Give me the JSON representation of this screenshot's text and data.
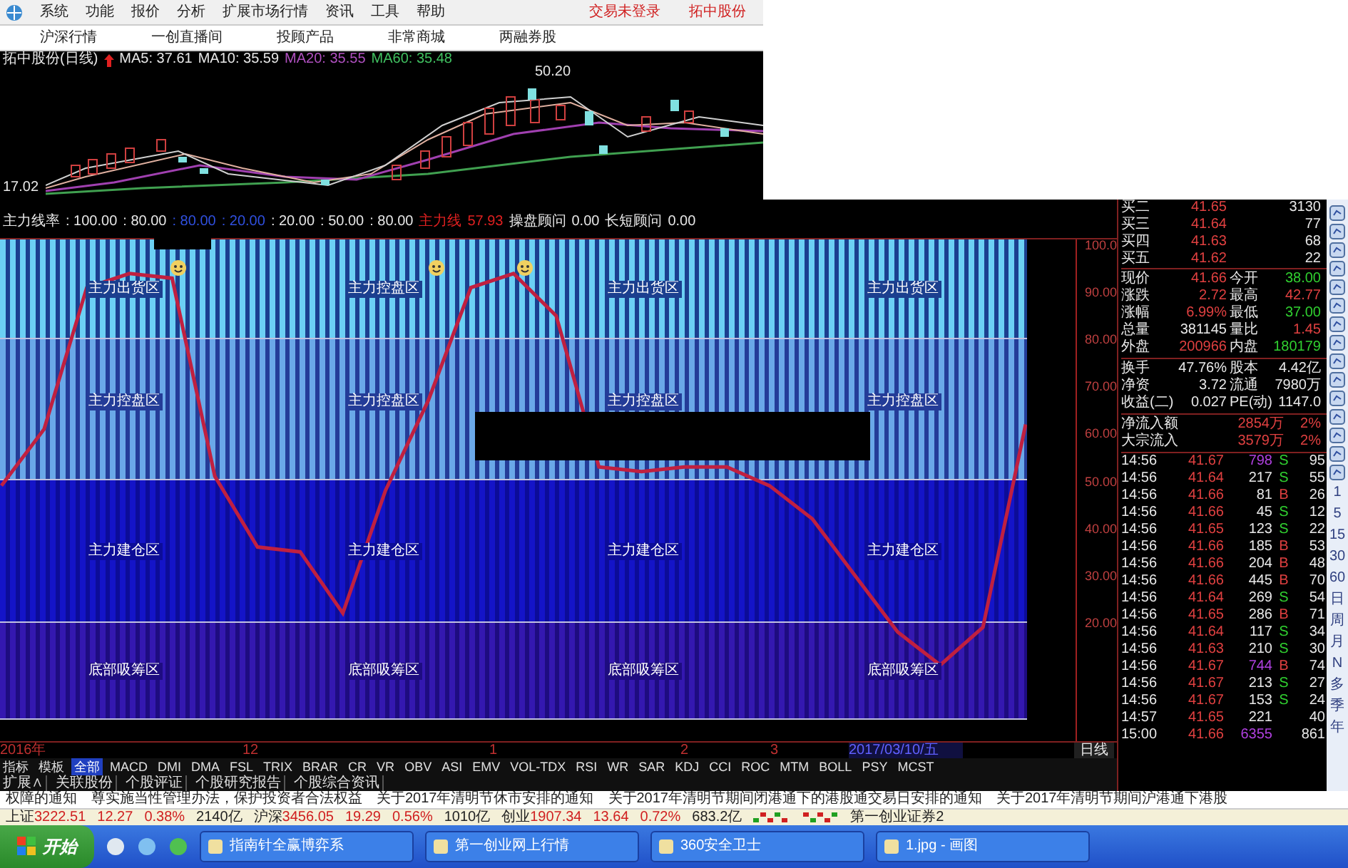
{
  "menu_bar": {
    "items": [
      "系统",
      "功能",
      "报价",
      "分析",
      "扩展市场行情",
      "资讯",
      "工具",
      "帮助"
    ],
    "status": [
      "交易未登录",
      "拓中股份"
    ]
  },
  "toolbar": {
    "items": [
      "沪深行情",
      "一创直播间",
      "投顾产品",
      "非常商城",
      "两融券股"
    ]
  },
  "kline": {
    "title": "拓中股份(日线)",
    "ma": [
      {
        "label": "MA5: 37.61",
        "color": "#e8e8e8"
      },
      {
        "label": "MA10: 35.59",
        "color": "#e8e8e8"
      },
      {
        "label": "MA20: 35.55",
        "color": "#b050c0"
      },
      {
        "label": "MA60: 35.48",
        "color": "#40c060"
      }
    ],
    "high_label": "50.20",
    "low_label": "17.02"
  },
  "indicator": {
    "header": [
      {
        "text": "主力线率",
        "color": "#e8e8e8"
      },
      {
        "text": ": 100.00",
        "color": "#e8e8e8"
      },
      {
        "text": ": 80.00",
        "color": "#e8e8e8"
      },
      {
        "text": ": 80.00",
        "color": "#3050e0"
      },
      {
        "text": ": 20.00",
        "color": "#3050e0"
      },
      {
        "text": ": 20.00",
        "color": "#e8e8e8"
      },
      {
        "text": ": 50.00",
        "color": "#e8e8e8"
      },
      {
        "text": ": 80.00",
        "color": "#e8e8e8"
      },
      {
        "text": "主力线",
        "color": "#e02020"
      },
      {
        "text": "57.93",
        "color": "#e02020"
      },
      {
        "text": "操盘顾问",
        "color": "#e8e8e8"
      },
      {
        "text": "0.00",
        "color": "#e8e8e8"
      },
      {
        "text": "长短顾问",
        "color": "#e8e8e8"
      },
      {
        "text": "0.00",
        "color": "#e8e8e8"
      }
    ],
    "zones": [
      {
        "kind": "top",
        "labels": [
          "主力出货区",
          "主力控盘区",
          "主力出货区",
          "主力出货区"
        ]
      },
      {
        "kind": "upper",
        "labels": [
          "主力控盘区",
          "主力控盘区",
          "主力控盘区",
          "主力控盘区"
        ]
      },
      {
        "kind": "lower",
        "labels": [
          "主力建仓区",
          "主力建仓区",
          "主力建仓区",
          "主力建仓区"
        ]
      },
      {
        "kind": "bottom",
        "labels": [
          "底部吸筹区",
          "底部吸筹区",
          "底部吸筹区",
          "底部吸筹区"
        ]
      }
    ],
    "chart_data": {
      "type": "line",
      "grid": true,
      "ylim": [
        0,
        100
      ],
      "yticks": [
        {
          "value": 100,
          "label": "100.0"
        },
        {
          "value": 90,
          "label": "90.00"
        },
        {
          "value": 80,
          "label": "80.00"
        },
        {
          "value": 70,
          "label": "70.00"
        },
        {
          "value": 60,
          "label": "60.00"
        },
        {
          "value": 50,
          "label": "50.00"
        },
        {
          "value": 40,
          "label": "40.00"
        },
        {
          "value": 30,
          "label": "30.00"
        },
        {
          "value": 20,
          "label": "20.00"
        }
      ],
      "series": [
        {
          "color": "#c02040",
          "values": [
            49,
            61,
            91,
            94,
            93,
            51,
            36,
            35,
            22,
            48,
            67,
            91,
            94,
            85,
            53,
            52,
            53,
            53,
            49,
            42,
            30,
            18,
            11,
            19,
            62
          ]
        }
      ]
    },
    "x_axis": [
      {
        "label": "2016年",
        "selected": false
      },
      {
        "label": "12",
        "selected": false
      },
      {
        "label": "1",
        "selected": false
      },
      {
        "label": "2",
        "selected": false
      },
      {
        "label": "3",
        "selected": false
      },
      {
        "label": "2017/03/10/五",
        "selected": true
      }
    ],
    "period_label": "日线"
  },
  "indicator_tabs": [
    {
      "label": "指标",
      "selected": false
    },
    {
      "label": "模板",
      "selected": false
    },
    {
      "label": "全部",
      "selected": true
    },
    {
      "label": "MACD",
      "selected": false
    },
    {
      "label": "DMI",
      "selected": false
    },
    {
      "label": "DMA",
      "selected": false
    },
    {
      "label": "FSL",
      "selected": false
    },
    {
      "label": "TRIX",
      "selected": false
    },
    {
      "label": "BRAR",
      "selected": false
    },
    {
      "label": "CR",
      "selected": false
    },
    {
      "label": "VR",
      "selected": false
    },
    {
      "label": "OBV",
      "selected": false
    },
    {
      "label": "ASI",
      "selected": false
    },
    {
      "label": "EMV",
      "selected": false
    },
    {
      "label": "VOL-TDX",
      "selected": false
    },
    {
      "label": "RSI",
      "selected": false
    },
    {
      "label": "WR",
      "selected": false
    },
    {
      "label": "SAR",
      "selected": false
    },
    {
      "label": "KDJ",
      "selected": false
    },
    {
      "label": "CCI",
      "selected": false
    },
    {
      "label": "ROC",
      "selected": false
    },
    {
      "label": "MTM",
      "selected": false
    },
    {
      "label": "BOLL",
      "selected": false
    },
    {
      "label": "PSY",
      "selected": false
    },
    {
      "label": "MCST",
      "selected": false
    }
  ],
  "extension_tabs": [
    "扩展∧",
    "关联股份",
    "个股评证",
    "个股研究报告",
    "个股综合资讯"
  ],
  "quote": {
    "bids": [
      {
        "label": "买二",
        "price": "41.65",
        "volume": "3130"
      },
      {
        "label": "买三",
        "price": "41.64",
        "volume": "77"
      },
      {
        "label": "买四",
        "price": "41.63",
        "volume": "68"
      },
      {
        "label": "买五",
        "price": "41.62",
        "volume": "22"
      }
    ],
    "stat_groups": [
      [
        [
          {
            "label": "现价",
            "value": "41.66",
            "color": "#e04040"
          },
          {
            "label": "今开",
            "value": "38.00",
            "color": "#30d030"
          }
        ],
        [
          {
            "label": "涨跌",
            "value": "2.72",
            "color": "#e04040"
          },
          {
            "label": "最高",
            "value": "42.77",
            "color": "#e04040"
          }
        ],
        [
          {
            "label": "涨幅",
            "value": "6.99%",
            "color": "#e04040"
          },
          {
            "label": "最低",
            "value": "37.00",
            "color": "#30d030"
          }
        ],
        [
          {
            "label": "总量",
            "value": "381145",
            "color": "#e8e8e8"
          },
          {
            "label": "量比",
            "value": "1.45",
            "color": "#e04040"
          }
        ],
        [
          {
            "label": "外盘",
            "value": "200966",
            "color": "#e04040"
          },
          {
            "label": "内盘",
            "value": "180179",
            "color": "#30d030"
          }
        ]
      ],
      [
        [
          {
            "label": "换手",
            "value": "47.76%",
            "color": "#e8e8e8"
          },
          {
            "label": "股本",
            "value": "4.42亿",
            "color": "#e8e8e8"
          }
        ],
        [
          {
            "label": "净资",
            "value": "3.72",
            "color": "#e8e8e8"
          },
          {
            "label": "流通",
            "value": "7980万",
            "color": "#e8e8e8"
          }
        ],
        [
          {
            "label": "收益(二)",
            "value": "0.027",
            "color": "#e8e8e8"
          },
          {
            "label": "PE(动)",
            "value": "1147.0",
            "color": "#e8e8e8"
          }
        ]
      ]
    ],
    "flows": [
      {
        "label": "净流入额",
        "value": "2854万",
        "pct": "2%"
      },
      {
        "label": "大宗流入",
        "value": "3579万",
        "pct": "2%"
      }
    ],
    "ticks": [
      {
        "time": "14:56",
        "price": "41.67",
        "volume": "798",
        "large": true,
        "kind": "sell",
        "side": "S",
        "count": "95"
      },
      {
        "time": "14:56",
        "price": "41.64",
        "volume": "217",
        "large": false,
        "kind": "sell",
        "side": "S",
        "count": "55"
      },
      {
        "time": "14:56",
        "price": "41.66",
        "volume": "81",
        "large": false,
        "kind": "buy",
        "side": "B",
        "count": "26"
      },
      {
        "time": "14:56",
        "price": "41.66",
        "volume": "45",
        "large": false,
        "kind": "sell",
        "side": "S",
        "count": "12"
      },
      {
        "time": "14:56",
        "price": "41.65",
        "volume": "123",
        "large": false,
        "kind": "sell",
        "side": "S",
        "count": "22"
      },
      {
        "time": "14:56",
        "price": "41.66",
        "volume": "185",
        "large": false,
        "kind": "buy",
        "side": "B",
        "count": "53"
      },
      {
        "time": "14:56",
        "price": "41.66",
        "volume": "204",
        "large": false,
        "kind": "buy",
        "side": "B",
        "count": "48"
      },
      {
        "time": "14:56",
        "price": "41.66",
        "volume": "445",
        "large": false,
        "kind": "buy",
        "side": "B",
        "count": "70"
      },
      {
        "time": "14:56",
        "price": "41.64",
        "volume": "269",
        "large": false,
        "kind": "sell",
        "side": "S",
        "count": "54"
      },
      {
        "time": "14:56",
        "price": "41.65",
        "volume": "286",
        "large": false,
        "kind": "buy",
        "side": "B",
        "count": "71"
      },
      {
        "time": "14:56",
        "price": "41.64",
        "volume": "117",
        "large": false,
        "kind": "sell",
        "side": "S",
        "count": "34"
      },
      {
        "time": "14:56",
        "price": "41.63",
        "volume": "210",
        "large": false,
        "kind": "sell",
        "side": "S",
        "count": "30"
      },
      {
        "time": "14:56",
        "price": "41.67",
        "volume": "744",
        "large": true,
        "kind": "buy",
        "side": "B",
        "count": "74"
      },
      {
        "time": "14:56",
        "price": "41.67",
        "volume": "213",
        "large": false,
        "kind": "sell",
        "side": "S",
        "count": "27"
      },
      {
        "time": "14:56",
        "price": "41.67",
        "volume": "153",
        "large": false,
        "kind": "sell",
        "side": "S",
        "count": "24"
      },
      {
        "time": "14:57",
        "price": "41.65",
        "volume": "221",
        "large": false,
        "count": "40"
      },
      {
        "time": "15:00",
        "price": "41.66",
        "volume": "6355",
        "large": true,
        "count": "861"
      }
    ]
  },
  "period_bar": [
    "1",
    "5",
    "15",
    "30",
    "60",
    "日",
    "周",
    "月",
    "N",
    "多",
    "季",
    "年"
  ],
  "news": [
    "权障的通知",
    "尊实施当性管理办法，保护投资者合法权益",
    "关于2017年清明节休市安排的通知",
    "关于2017年清明节期间闭港通下的港股通交易日安排的通知",
    "关于2017年清明节期间沪港通下港股"
  ],
  "indices": [
    {
      "name": "上证",
      "value": "3222.51",
      "change": "12.27",
      "pct": "0.38%",
      "amount": "2140亿"
    },
    {
      "name": "沪深",
      "value": "3456.05",
      "change": "19.29",
      "pct": "0.56%",
      "amount": "1010亿"
    },
    {
      "name": "创业",
      "value": "1907.34",
      "change": "13.64",
      "pct": "0.72%",
      "amount": "683.2亿"
    }
  ],
  "broker": "第一创业证券2",
  "taskbar": {
    "start": "开始",
    "tasks": [
      "指南针全赢博弈系",
      "第一创业网上行情",
      "360安全卫士",
      "1.jpg - 画图"
    ]
  }
}
